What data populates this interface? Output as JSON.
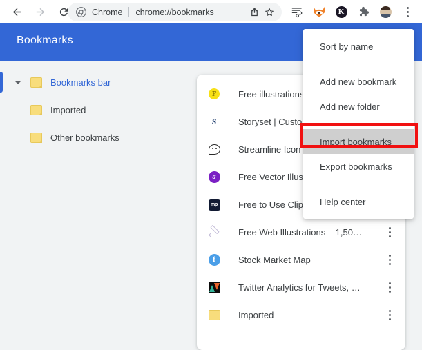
{
  "browser": {
    "nav": {
      "back_label": "Back",
      "forward_label": "Forward",
      "reload_label": "Reload"
    },
    "omnibox": {
      "chrome_label": "Chrome",
      "url": "chrome://bookmarks",
      "url_scheme": "chrome://",
      "url_path": "bookmarks",
      "share_icon": "share-icon",
      "bookmark_star_icon": "star-icon"
    },
    "extensions": [
      {
        "name": "reading-list-icon",
        "glyph": "clip"
      },
      {
        "name": "metamask-fox-icon",
        "glyph": "fox"
      },
      {
        "name": "keplr-wallet-icon",
        "glyph": "K"
      },
      {
        "name": "extensions-puzzle-icon",
        "glyph": "puzzle"
      },
      {
        "name": "profile-avatar-icon",
        "glyph": "avatar"
      },
      {
        "name": "chrome-menu-icon",
        "glyph": "kebab"
      }
    ]
  },
  "bookmarks_page": {
    "header_title": "Bookmarks",
    "header_color": "#3367d6",
    "tree": [
      {
        "label": "Bookmarks bar",
        "selected": true,
        "expanded": true,
        "indent": 0
      },
      {
        "label": "Imported",
        "selected": false,
        "expanded": false,
        "indent": 1
      },
      {
        "label": "Other bookmarks",
        "selected": false,
        "expanded": false,
        "indent": 0
      }
    ],
    "list": [
      {
        "title": "Free illustrations",
        "favicon": "yellow-circle-icon",
        "glyph": "F"
      },
      {
        "title": "Storyset | Custo",
        "favicon": "storyset-icon",
        "glyph": "S"
      },
      {
        "title": "Streamline Icon",
        "favicon": "chat-bubble-icon",
        "glyph": ""
      },
      {
        "title": "Free Vector Illus",
        "favicon": "purple-circle-icon",
        "glyph": "a"
      },
      {
        "title": "Free to Use Clip Art Images ...",
        "favicon": "mp-square-icon",
        "glyph": "mp"
      },
      {
        "title": "Free Web Illustrations – 1,50…",
        "favicon": "pencil-icon",
        "glyph": ""
      },
      {
        "title": "Stock Market Map",
        "favicon": "blue-circle-icon",
        "glyph": "f"
      },
      {
        "title": "Twitter Analytics for Tweets, …",
        "favicon": "triangles-icon",
        "glyph": ""
      },
      {
        "title": "Imported",
        "favicon": "folder-icon",
        "glyph": ""
      }
    ]
  },
  "menu": {
    "items": [
      {
        "label": "Sort by name",
        "highlighted": false
      },
      {
        "label": "Add new bookmark",
        "highlighted": false
      },
      {
        "label": "Add new folder",
        "highlighted": false
      },
      {
        "label": "Import bookmarks",
        "highlighted": true
      },
      {
        "label": "Export bookmarks",
        "highlighted": false
      },
      {
        "label": "Help center",
        "highlighted": false
      }
    ],
    "highlight_color": "#f11111"
  }
}
